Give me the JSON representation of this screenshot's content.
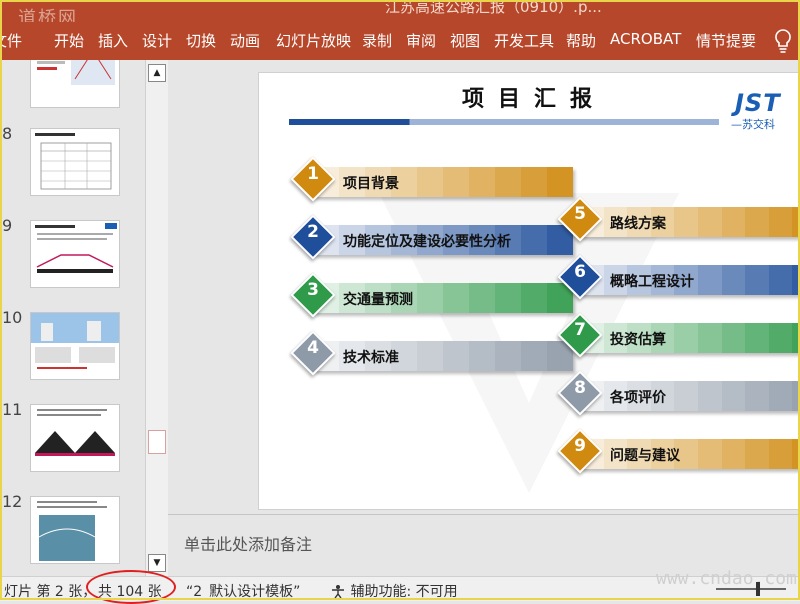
{
  "window": {
    "title": "江苏高速公路汇报（0910）.p...",
    "watermark_top": "道桥网",
    "watermark_bottom": "www.cndao.com"
  },
  "ribbon": {
    "tabs": [
      "文件",
      "开始",
      "插入",
      "设计",
      "切换",
      "动画",
      "幻灯片放映",
      "录制",
      "审阅",
      "视图",
      "开发工具",
      "帮助",
      "ACROBAT",
      "情节提要"
    ],
    "lightbulb_icon": "lightbulb-icon"
  },
  "thumbnails": {
    "numbers": [
      "8",
      "9",
      "10",
      "11",
      "12"
    ]
  },
  "slide": {
    "title": "项目汇报",
    "logo_main": "JST",
    "logo_sub": "—苏交科",
    "items_left": [
      {
        "num": "1",
        "label": "项目背景",
        "color": "#d08a10"
      },
      {
        "num": "2",
        "label": "功能定位及建设必要性分析",
        "color": "#1f4e9a"
      },
      {
        "num": "3",
        "label": "交通量预测",
        "color": "#2e9a4a"
      },
      {
        "num": "4",
        "label": "技术标准",
        "color": "#8e9aa8"
      }
    ],
    "items_right": [
      {
        "num": "5",
        "label": "路线方案",
        "color": "#d08a10"
      },
      {
        "num": "6",
        "label": "概略工程设计",
        "color": "#1f4e9a"
      },
      {
        "num": "7",
        "label": "投资估算",
        "color": "#2e9a4a"
      },
      {
        "num": "8",
        "label": "各项评价",
        "color": "#8e9aa8"
      },
      {
        "num": "9",
        "label": "问题与建议",
        "color": "#d08a10"
      }
    ]
  },
  "notes": {
    "placeholder": "单击此处添加备注"
  },
  "status": {
    "slide_index": "灯片 第 2 张，",
    "slide_total": "共 104 张",
    "template": "“2_默认设计模板”",
    "accessibility": "辅助功能: 不可用"
  }
}
